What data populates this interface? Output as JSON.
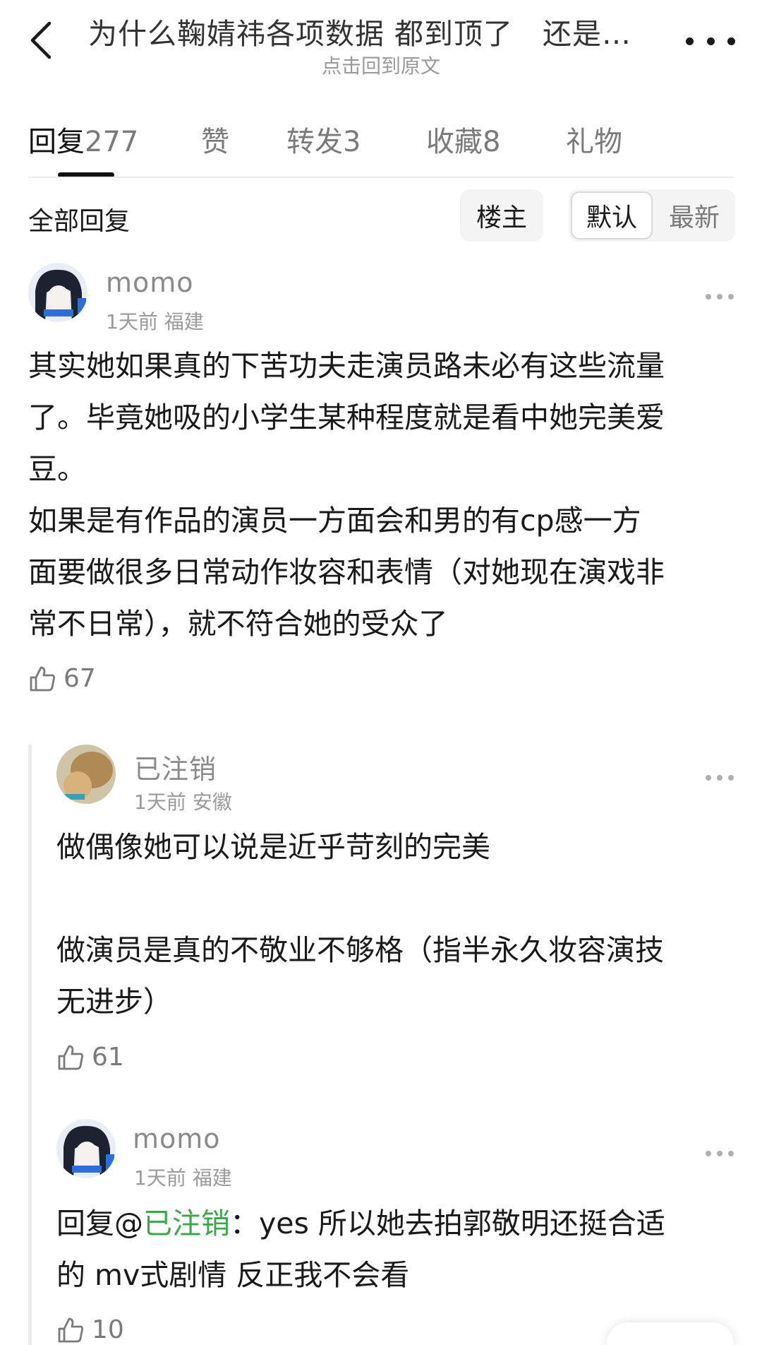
{
  "header": {
    "title": "为什么鞠婧祎各项数据 都到顶了　还是…",
    "subtitle": "点击回到原文"
  },
  "tabs": [
    {
      "label": "回复",
      "count": "277"
    },
    {
      "label": "赞",
      "count": ""
    },
    {
      "label": "转发",
      "count": "3"
    },
    {
      "label": "收藏",
      "count": "8"
    },
    {
      "label": "礼物",
      "count": ""
    }
  ],
  "filter": {
    "label": "全部回复",
    "host_only": "楼主",
    "sort_default": "默认",
    "sort_newest": "最新"
  },
  "comments": [
    {
      "username": "momo",
      "time": "1天前",
      "location": "福建",
      "lines": [
        "其实她如果真的下苦功夫走演员路未必有这些流量",
        "了。毕竟她吸的小学生某种程度就是看中她完美爱",
        "豆。",
        "如果是有作品的演员一方面会和男的有cp感一方",
        "面要做很多日常动作妆容和表情（对她现在演戏非",
        "常不日常），就不符合她的受众了"
      ],
      "likes": "67"
    },
    {
      "username": "已注销",
      "time": "1天前",
      "location": "安徽",
      "lines": [
        "做偶像她可以说是近乎苛刻的完美",
        "",
        "做演员是真的不敬业不够格（指半永久妆容演技",
        "无进步）"
      ],
      "likes": "61"
    },
    {
      "username": "momo",
      "time": "1天前",
      "location": "福建",
      "reply_prefix": "回复@",
      "reply_to": "已注销",
      "line1_rest": "：yes 所以她去拍郭敬明还挺合适",
      "line2": "的 mv式剧情 反正我不会看",
      "likes": "10"
    }
  ],
  "icons": {
    "back": "back-arrow-icon",
    "more": "more-horizontal-icon",
    "like": "thumbs-up-icon",
    "comment_more": "more-dots-icon"
  },
  "colors": {
    "mention": "#3aa84a",
    "active_tab": "#111111",
    "muted": "#7a7a7a"
  }
}
